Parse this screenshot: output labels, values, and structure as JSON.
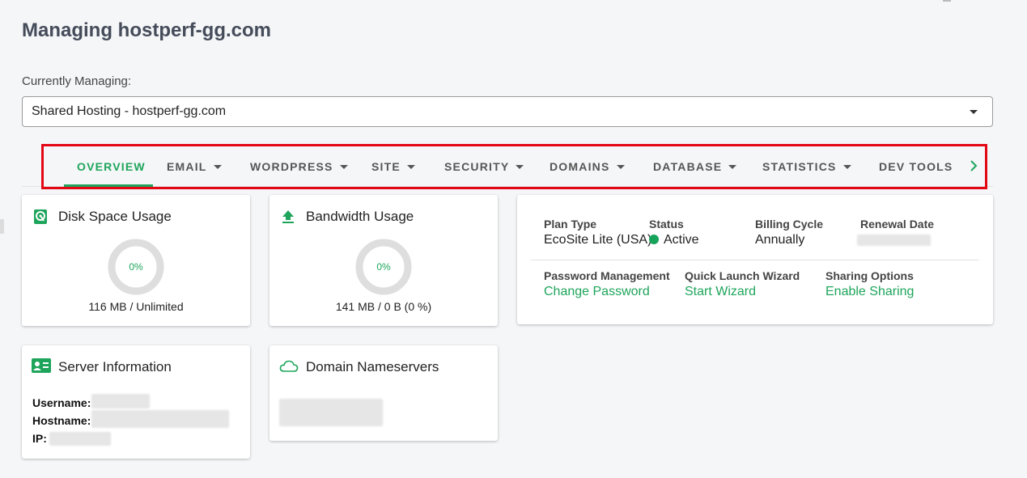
{
  "page": {
    "title": "Managing hostperf-gg.com",
    "managing_label": "Currently Managing:",
    "select_value": "Shared Hosting - hostperf-gg.com"
  },
  "tabs": [
    {
      "label": "OVERVIEW",
      "active": true,
      "dropdown": false
    },
    {
      "label": "EMAIL",
      "active": false,
      "dropdown": true
    },
    {
      "label": "WORDPRESS",
      "active": false,
      "dropdown": true
    },
    {
      "label": "SITE",
      "active": false,
      "dropdown": true
    },
    {
      "label": "SECURITY",
      "active": false,
      "dropdown": true
    },
    {
      "label": "DOMAINS",
      "active": false,
      "dropdown": true
    },
    {
      "label": "DATABASE",
      "active": false,
      "dropdown": true
    },
    {
      "label": "STATISTICS",
      "active": false,
      "dropdown": true
    },
    {
      "label": "DEV TOOLS",
      "active": false,
      "dropdown": false
    }
  ],
  "disk": {
    "title": "Disk Space Usage",
    "percent_label": "0%",
    "percent": 0,
    "usage": "116 MB / Unlimited",
    "icon": "disk-icon"
  },
  "bandwidth": {
    "title": "Bandwidth Usage",
    "percent_label": "0%",
    "percent": 0,
    "usage": "141 MB / 0 B (0 %)",
    "icon": "upload-icon"
  },
  "plan": {
    "plan_type_label": "Plan Type",
    "plan_type_value": "EcoSite Lite (USA)",
    "status_label": "Status",
    "status_value": "Active",
    "billing_label": "Billing Cycle",
    "billing_value": "Annually",
    "renewal_label": "Renewal Date",
    "password_label": "Password Management",
    "password_link": "Change Password",
    "wizard_label": "Quick Launch Wizard",
    "wizard_link": "Start Wizard",
    "sharing_label": "Sharing Options",
    "sharing_link": "Enable Sharing"
  },
  "server": {
    "title": "Server Information",
    "username_label": "Username:",
    "hostname_label": "Hostname:",
    "ip_label": "IP:",
    "icon": "id-card-icon"
  },
  "nameservers": {
    "title": "Domain Nameservers",
    "icon": "cloud-icon"
  },
  "colors": {
    "accent": "#1ea55b",
    "highlight_frame": "#e30613",
    "status_active": "#16a35a"
  }
}
